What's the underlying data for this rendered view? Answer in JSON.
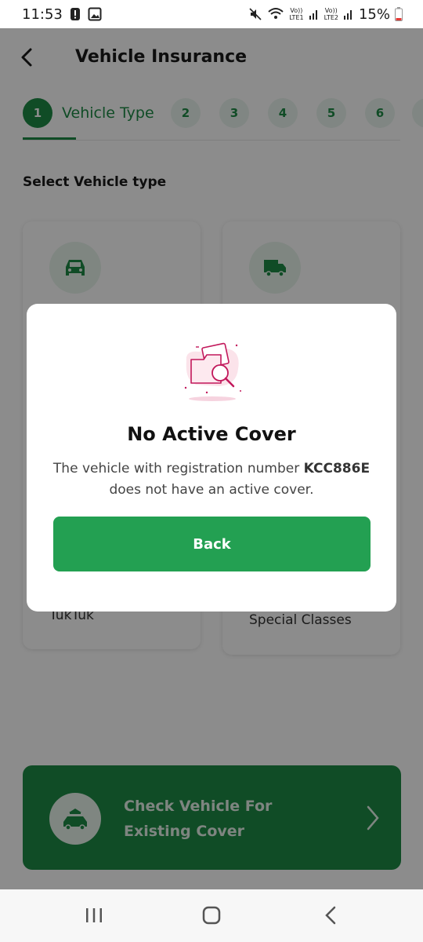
{
  "status_bar": {
    "time": "11:53",
    "battery": "15%",
    "sim1": "LTE1",
    "sim2": "LTE2",
    "volte": "Vo))"
  },
  "header": {
    "title": "Vehicle Insurance"
  },
  "stepper": {
    "active_number": "1",
    "active_label": "Vehicle Type",
    "steps": [
      "2",
      "3",
      "4",
      "5",
      "6"
    ]
  },
  "section": {
    "title": "Select Vehicle type"
  },
  "vehicle_types": {
    "tuktuk": "TukTuk",
    "special": "Special Classes"
  },
  "banner": {
    "line1": "Check Vehicle For",
    "line2": "Existing Cover"
  },
  "dialog": {
    "title": "No Active Cover",
    "message_prefix": "The vehicle with registration number ",
    "registration": "KCC886E",
    "message_suffix": " does not have an active cover.",
    "button": "Back"
  },
  "colors": {
    "primary": "#1e8a46",
    "button": "#23a052",
    "icon_bg": "#e8f4ec",
    "illustration": "#c2185b"
  },
  "icons": [
    "back-arrow-icon",
    "car-icon",
    "truck-icon",
    "folder-search-icon",
    "car-roof-icon",
    "chevron-right-icon",
    "recents-icon",
    "home-icon",
    "nav-back-icon"
  ]
}
